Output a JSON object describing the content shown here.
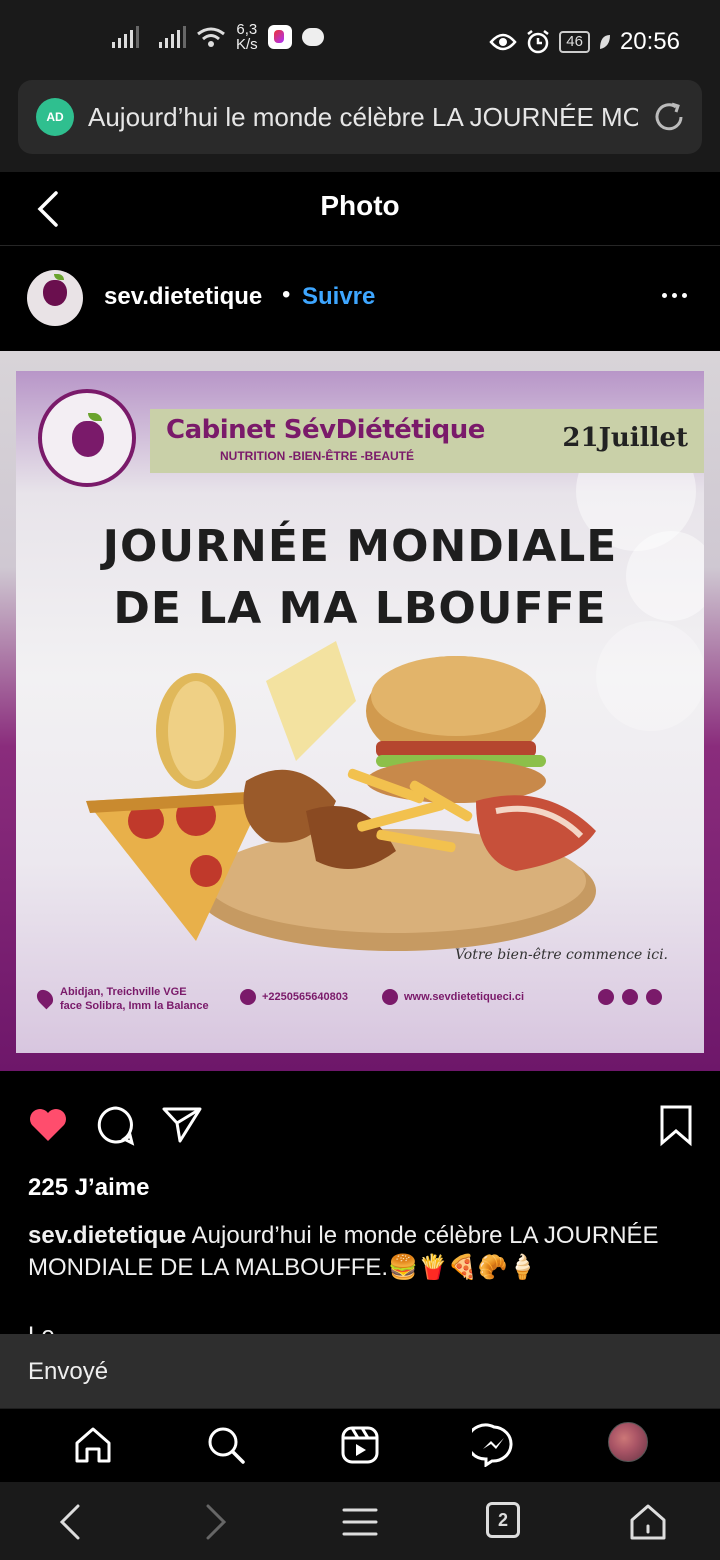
{
  "status_bar": {
    "speed_value": "6,3",
    "speed_unit": "K/s",
    "battery": "46",
    "time": "20:56"
  },
  "address_bar": {
    "ad_badge": "AD",
    "page_title": "Aujourd’hui le monde célèbre LA JOURNÉE MO"
  },
  "app_header": {
    "title": "Photo"
  },
  "post": {
    "username": "sev.dietetique",
    "separator": "•",
    "follow_label": "Suivre",
    "likes": "225 J’aime",
    "caption_user": "sev.dietetique",
    "caption_text": " Aujourd’hui le monde célèbre LA JOURNÉE MONDIALE DE LA MALBOUFFE.",
    "caption_emojis": "🍔🍟🍕🥐🍦",
    "caption_more": "Le"
  },
  "poster": {
    "brand": "Cabinet SévDiététique",
    "tagline": "NUTRITION -BIEN-ÊTRE -BEAUTÉ",
    "date": "21Juillet",
    "headline_line1": "JOURNÉE MONDIALE",
    "headline_line2": "DE LA MA LBOUFFE",
    "slogan": "Votre bien-être commence ici.",
    "address_line1": "Abidjan, Treichville VGE",
    "address_line2": "face Solibra, Imm la Balance",
    "phone": "+2250565640803",
    "website": "www.sevdietetiqueci.ci"
  },
  "toast": {
    "message": "Envoyé"
  },
  "browser_nav": {
    "tab_count": "2"
  },
  "colors": {
    "follow_blue": "#3ea6ff",
    "like_red": "#ff4d6d",
    "brand_purple": "#7a1a6a"
  }
}
